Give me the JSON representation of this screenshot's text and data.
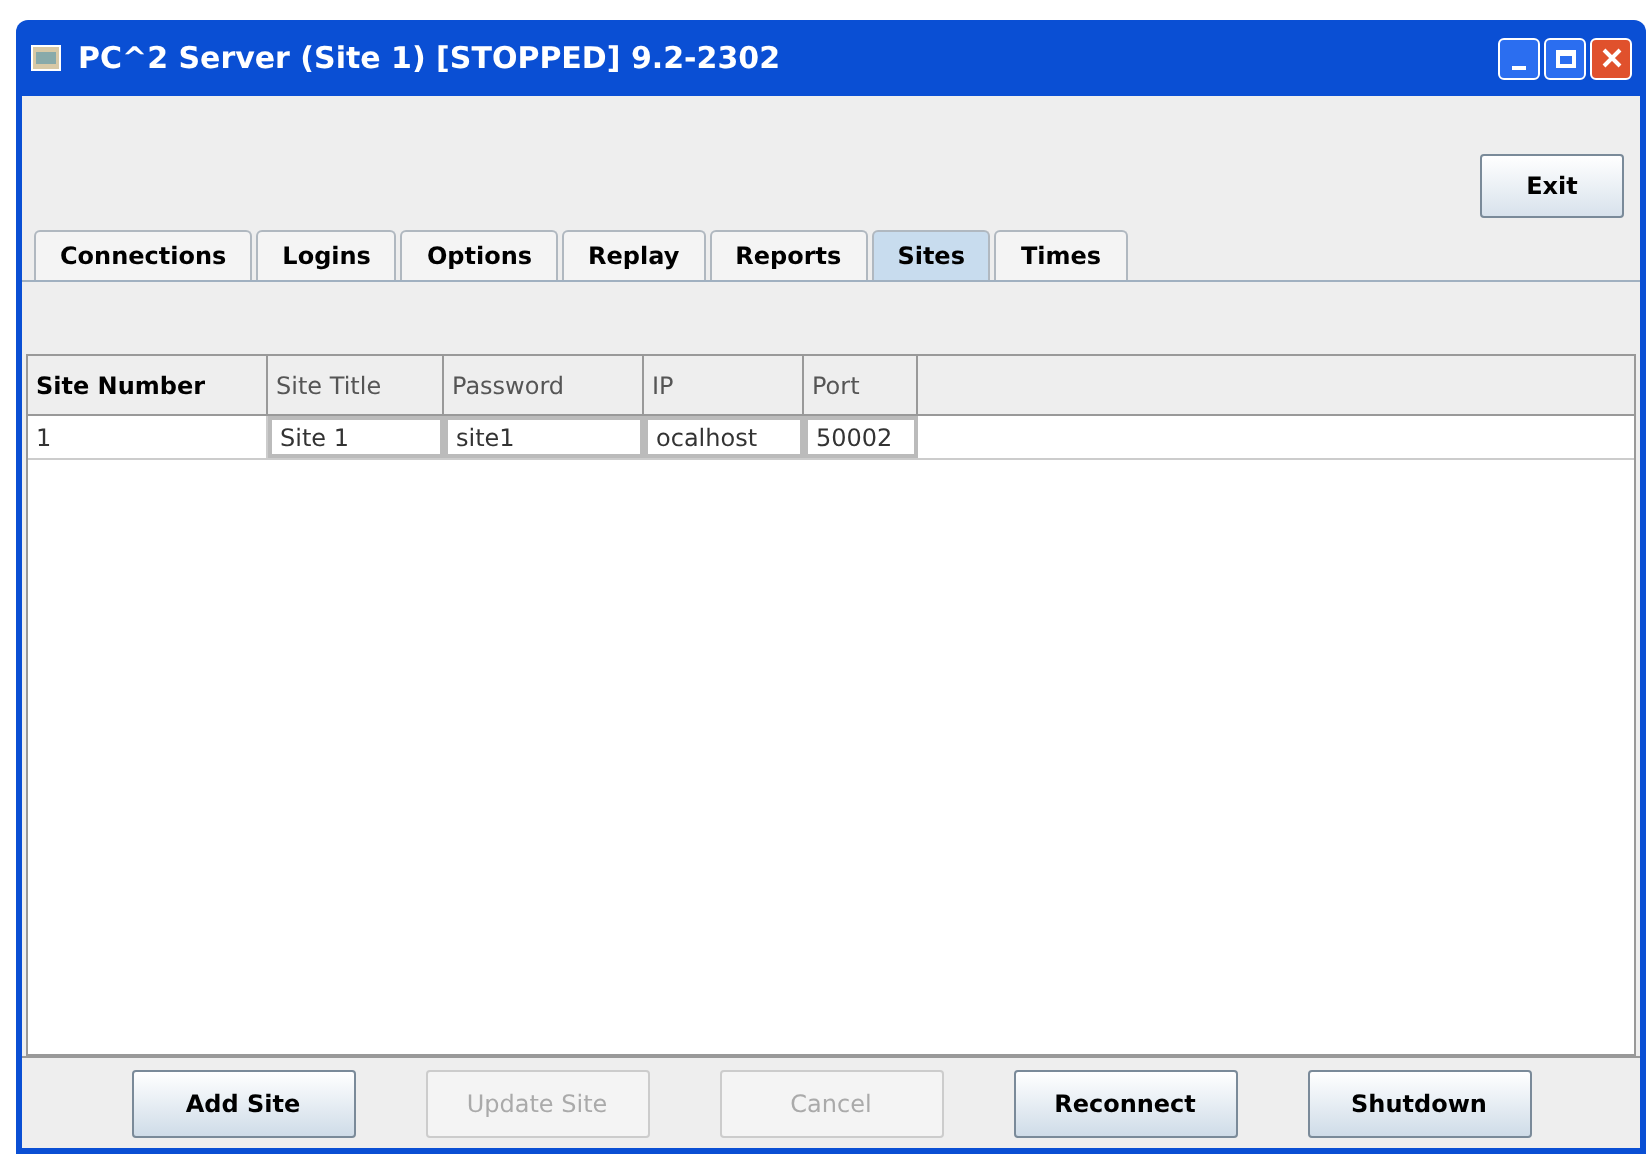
{
  "window": {
    "title": "PC^2 Server (Site 1) [STOPPED] 9.2-2302"
  },
  "exit_button": {
    "label": "Exit"
  },
  "tabs": [
    {
      "label": "Connections",
      "selected": false
    },
    {
      "label": "Logins",
      "selected": false
    },
    {
      "label": "Options",
      "selected": false
    },
    {
      "label": "Replay",
      "selected": false
    },
    {
      "label": "Reports",
      "selected": false
    },
    {
      "label": "Sites",
      "selected": true
    },
    {
      "label": "Times",
      "selected": false
    }
  ],
  "table": {
    "columns": [
      "Site Number",
      "Site Title",
      "Password",
      "IP",
      "Port"
    ],
    "rows": [
      [
        "1",
        "Site 1",
        "site1",
        "ocalhost",
        "50002"
      ]
    ]
  },
  "buttons": [
    {
      "label": "Add Site",
      "disabled": false
    },
    {
      "label": "Update Site",
      "disabled": true
    },
    {
      "label": "Cancel",
      "disabled": true
    },
    {
      "label": "Reconnect",
      "disabled": false
    },
    {
      "label": "Shutdown",
      "disabled": false
    }
  ]
}
